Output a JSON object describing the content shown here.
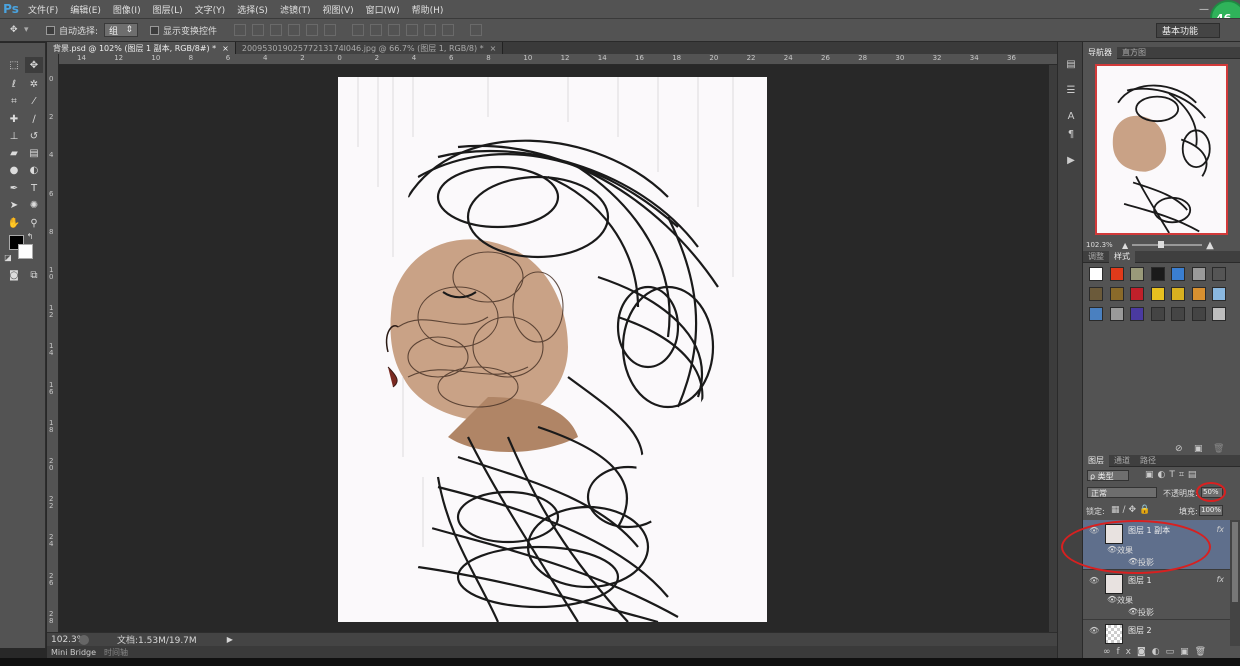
{
  "app": {
    "logo": "Ps"
  },
  "menu": [
    "文件(F)",
    "编辑(E)",
    "图像(I)",
    "图层(L)",
    "文字(Y)",
    "选择(S)",
    "滤镜(T)",
    "视图(V)",
    "窗口(W)",
    "帮助(H)"
  ],
  "badge": "46",
  "options": {
    "auto_select_label": "自动选择:",
    "auto_select_value": "组",
    "show_transform_label": "显示变换控件",
    "workspace": "基本功能"
  },
  "tabs": [
    "背景.psd @ 102% (图层 1 副本, RGB/8#) *",
    "20095301902577213174l046.jpg @ 66.7% (图层 1, RGB/8) *"
  ],
  "ruler": {
    "h": [
      "14",
      "12",
      "10",
      "8",
      "6",
      "4",
      "2",
      "0",
      "2",
      "4",
      "6",
      "8",
      "10",
      "12",
      "14",
      "16",
      "18",
      "20",
      "22",
      "24",
      "26",
      "28",
      "30",
      "32",
      "34",
      "36"
    ],
    "v": [
      "0",
      "2",
      "4",
      "6",
      "8",
      "1\n0",
      "1\n2",
      "1\n4",
      "1\n6",
      "1\n8",
      "2\n0",
      "2\n2",
      "2\n4",
      "2\n6",
      "2\n8"
    ]
  },
  "status": {
    "zoom": "102.3%",
    "doc": "文档:1.53M/19.7M"
  },
  "bottom_tabs": [
    "Mini Bridge",
    "时间轴"
  ],
  "navigator": {
    "tabs": [
      "导航器",
      "直方图"
    ],
    "zoom": "102.3%"
  },
  "styles_panel": {
    "tabs": [
      "调整",
      "样式"
    ]
  },
  "swatch_colors": [
    "#ffffff",
    "#e03a1a",
    "#9a9a7a",
    "#1a1a1a",
    "#3a7ed0",
    "#9a9a9a",
    "#555555",
    "#6b5a3a",
    "#8a6a2a",
    "#c0202a",
    "#e8c020",
    "#d8b020",
    "#d89030",
    "#8ab8e0",
    "#4a80c0",
    "#9a9a9a",
    "#4a3aa0",
    "#444444",
    "#454545",
    "#444444",
    "#bdbdbd"
  ],
  "layers_panel": {
    "tabs": [
      "图层",
      "通道",
      "路径"
    ],
    "filter_kind": "ρ 类型",
    "blend_mode": "正常",
    "opacity_label": "不透明度:",
    "opacity_value": "50%",
    "lock_label": "锁定:",
    "fill_label": "填充:",
    "fill_value": "100%",
    "layers": [
      {
        "name": "图层 1 副本",
        "effects_label": "效果",
        "effect": "投影",
        "selected": true
      },
      {
        "name": "图层 1",
        "effects_label": "效果",
        "effect": "投影",
        "selected": false
      },
      {
        "name": "图层 2",
        "effects_label": "",
        "effect": "",
        "selected": false
      }
    ],
    "fx_label": "fx"
  }
}
